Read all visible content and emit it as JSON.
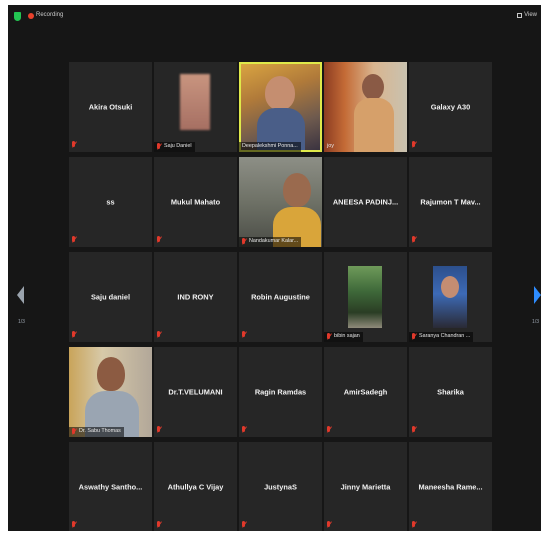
{
  "topbar": {
    "recording_label": "Recording",
    "view_label": "View"
  },
  "pagination": {
    "left": "1/3",
    "right": "1/3"
  },
  "colors": {
    "active_speaker": "#dfe94a",
    "muted": "#e0392b",
    "next_arrow": "#2d8cff"
  },
  "participants": [
    {
      "name": "Akira Otsuki",
      "video": false
    },
    {
      "name": "Saju Daniel",
      "video": true
    },
    {
      "name": "Deepalekshmi Ponna...",
      "video": true,
      "active": true
    },
    {
      "name": "joy",
      "video": true
    },
    {
      "name": "Galaxy A30",
      "video": false
    },
    {
      "name": "ss",
      "video": false
    },
    {
      "name": "Mukul Mahato",
      "video": false
    },
    {
      "name": "Nandakumar Kalar...",
      "video": true
    },
    {
      "name": "ANEESA PADINJ...",
      "video": false
    },
    {
      "name": "Rajumon T Mav...",
      "video": false
    },
    {
      "name": "Saju daniel",
      "video": false
    },
    {
      "name": "IND RONY",
      "video": false
    },
    {
      "name": "Robin Augustine",
      "video": false
    },
    {
      "name": "bibin sajan",
      "video": true
    },
    {
      "name": "Saranya Chandran ...",
      "video": true
    },
    {
      "name": "Dr. Sabu Thomas",
      "video": true
    },
    {
      "name": "Dr.T.VELUMANI",
      "video": false
    },
    {
      "name": "Ragin Ramdas",
      "video": false
    },
    {
      "name": "AmirSadegh",
      "video": false
    },
    {
      "name": "Sharika",
      "video": false
    },
    {
      "name": "Aswathy  Santho...",
      "video": false
    },
    {
      "name": "Athullya C Vijay",
      "video": false
    },
    {
      "name": "JustynaS",
      "video": false
    },
    {
      "name": "Jinny Marietta",
      "video": false
    },
    {
      "name": "Maneesha  Rame...",
      "video": false
    }
  ]
}
